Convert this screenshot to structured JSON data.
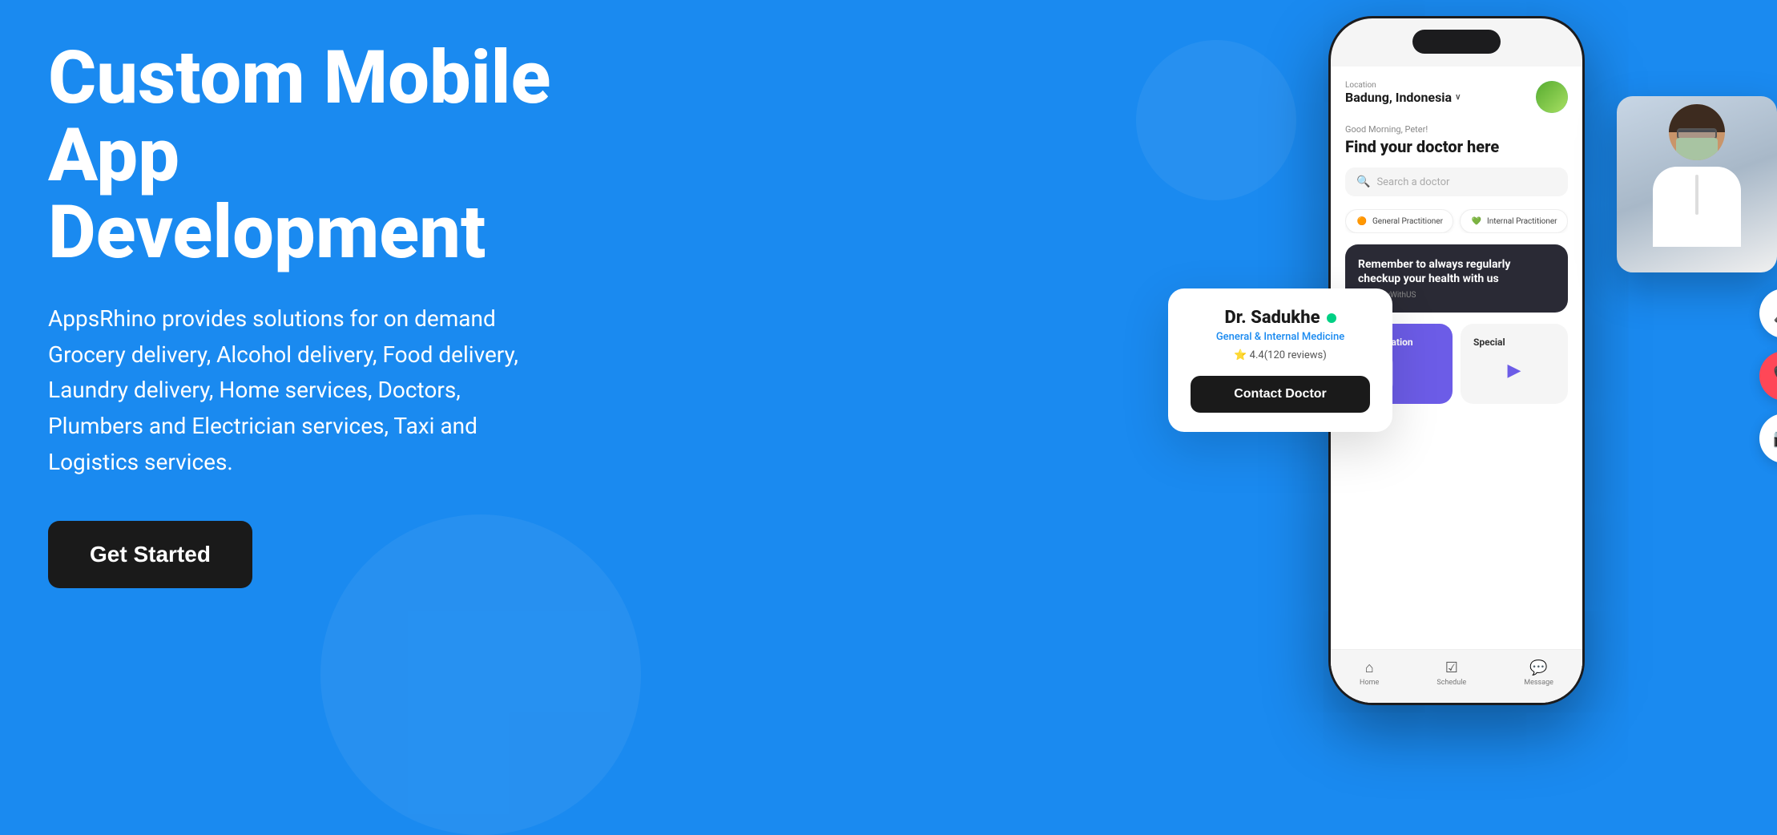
{
  "background_color": "#1a8af0",
  "hero": {
    "title_line1": "Custom Mobile",
    "title_line2": "App",
    "title_line3": "Development",
    "description": "AppsRhino provides solutions for on demand Grocery delivery, Alcohol delivery, Food delivery, Laundry delivery, Home services, Doctors, Plumbers and Electrician services, Taxi and Logistics services.",
    "cta_label": "Get Started"
  },
  "phone": {
    "location_label": "Location",
    "location_name": "Badung, Indonesia",
    "greeting": "Good Morning, Peter!",
    "find_doctor": "Find your doctor here",
    "search_placeholder": "Search a doctor",
    "categories": [
      {
        "label": "General Practitioner",
        "icon": "🟠"
      },
      {
        "label": "Internal Practitioner",
        "icon": "💚"
      }
    ],
    "reminder": {
      "text": "Remember to always regularly checkup your health with us",
      "hashtag": "#HealthyWithUS"
    },
    "services": [
      {
        "label": "Consultation",
        "type": "consultation"
      },
      {
        "label": "Special",
        "type": "special"
      }
    ],
    "nav_items": [
      {
        "label": "Home",
        "icon": "🏠"
      },
      {
        "label": "Schedule",
        "icon": "📅"
      },
      {
        "label": "Message",
        "icon": "💬"
      }
    ]
  },
  "doctor_card": {
    "name": "Dr. Sadukhe",
    "online": true,
    "specialty": "General & Internal Medicine",
    "rating": "4.4",
    "reviews": "120 reviews",
    "contact_label": "Contact Doctor"
  },
  "call_controls": {
    "mute_icon": "🎤",
    "hangup_icon": "📞",
    "video_icon": "📹"
  },
  "icons": {
    "search": "🔍",
    "chevron_down": "∨",
    "star": "⭐",
    "home": "⌂",
    "schedule": "☑",
    "message": "💬",
    "mic_off": "🎤",
    "phone_hang": "📞",
    "camera": "📷"
  }
}
